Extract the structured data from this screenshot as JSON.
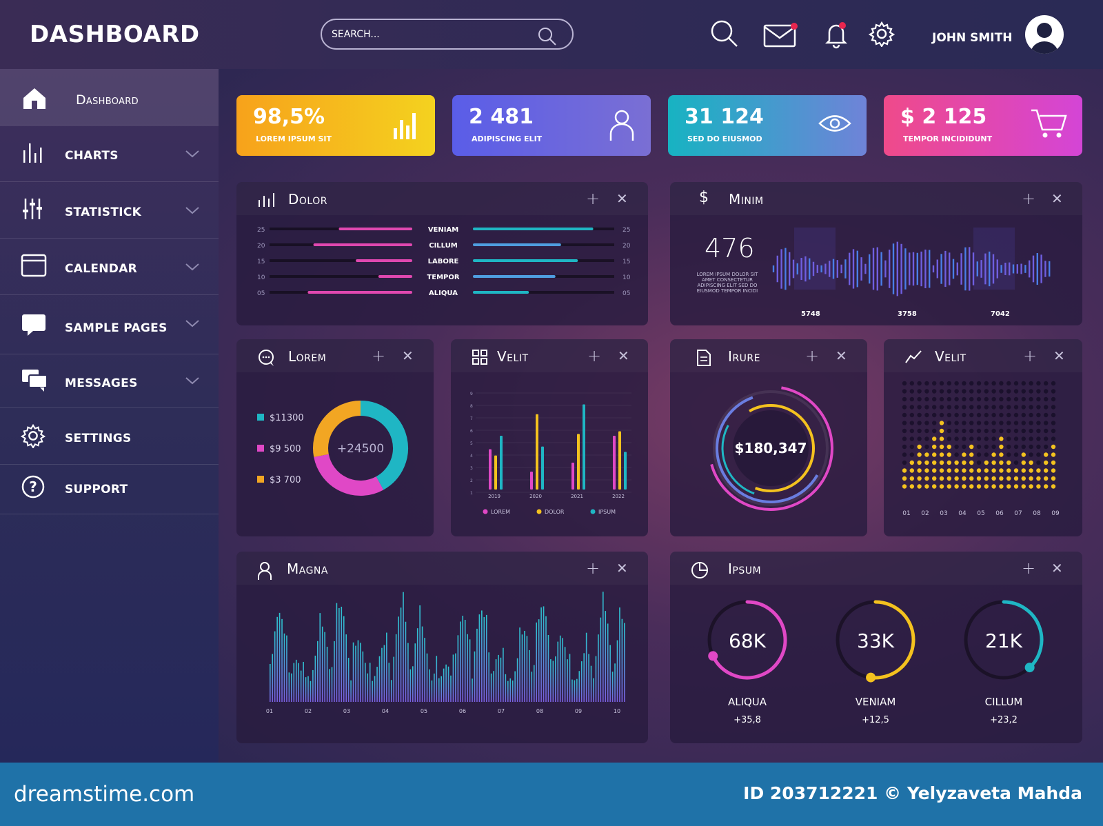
{
  "header": {
    "title": "DASHBOARD",
    "search_placeholder": "SEARCH...",
    "user_name": "JOHN SMITH"
  },
  "sidebar": {
    "items": [
      {
        "label": "Dashboard",
        "icon": "home-icon"
      },
      {
        "label": "CHARTS",
        "icon": "bar-chart-icon"
      },
      {
        "label": "STATISTICK",
        "icon": "sliders-icon"
      },
      {
        "label": "CALENDAR",
        "icon": "calendar-icon"
      },
      {
        "label": "SAMPLE PAGES",
        "icon": "pages-icon"
      },
      {
        "label": "MESSAGES",
        "icon": "messages-icon"
      },
      {
        "label": "SETTINGS",
        "icon": "gear-icon"
      },
      {
        "label": "SUPPORT",
        "icon": "help-icon"
      }
    ]
  },
  "stats": [
    {
      "value": "98,5%",
      "label": "LOREM IPSUM SIT",
      "icon": "bar-chart-icon",
      "colors": [
        "#f7a21b",
        "#f4d21f"
      ]
    },
    {
      "value": "2 481",
      "label": "ADIPISCING ELIT",
      "icon": "user-icon",
      "colors": [
        "#5a5de8",
        "#7a6fd4"
      ]
    },
    {
      "value": "31 124",
      "label": "SED DO EIUSMOD",
      "icon": "eye-icon",
      "colors": [
        "#17b3c2",
        "#6f83d8"
      ]
    },
    {
      "value": "$ 2 125",
      "label": "TEMPOR INCIDIDUNT",
      "icon": "cart-icon",
      "colors": [
        "#ef4a8a",
        "#d445d6"
      ]
    }
  ],
  "panels": {
    "dolor": {
      "title": "Dolor",
      "rows": [
        "VENIAM",
        "CILLUM",
        "LABORE",
        "TEMPOR",
        "ALIQUA"
      ],
      "left_ticks": [
        "25",
        "20",
        "15",
        "10",
        "05"
      ],
      "right_ticks": [
        "25",
        "20",
        "15",
        "10",
        "05"
      ],
      "left_values": [
        0.5,
        0.68,
        0.38,
        0.22,
        0.72
      ],
      "right_values": [
        0.84,
        0.61,
        0.73,
        0.57,
        0.38
      ]
    },
    "minim": {
      "title": "Minim",
      "value": "476",
      "text": "LOREM IPSUM DOLOR SIT AMET CONSECTETUR ADIPISCING ELIT SED DO EIUSMOD TEMPOR INCIDI",
      "labels": [
        "5748",
        "3758",
        "7042"
      ]
    },
    "lorem": {
      "title": "Lorem",
      "center": "+24500",
      "legend": [
        {
          "label": "$11300",
          "color": "#1fb6c4"
        },
        {
          "label": "$9 500",
          "color": "#e048c6"
        },
        {
          "label": "$3 700",
          "color": "#f2a623"
        }
      ]
    },
    "velit1": {
      "title": "Velit",
      "years": [
        "2019",
        "2020",
        "2021",
        "2022"
      ],
      "legend": [
        "LOREM",
        "DOLOR",
        "IPSUM"
      ],
      "y_ticks": [
        "9",
        "8",
        "7",
        "6",
        "5",
        "4",
        "3",
        "2",
        "1"
      ]
    },
    "irure": {
      "title": "Irure",
      "value": "$180,347"
    },
    "velit2": {
      "title": "Velit",
      "x": [
        "01",
        "02",
        "03",
        "04",
        "05",
        "06",
        "07",
        "08",
        "09"
      ]
    },
    "magna": {
      "title": "Magna",
      "x": [
        "01",
        "02",
        "03",
        "04",
        "05",
        "06",
        "07",
        "08",
        "09",
        "10"
      ]
    },
    "ipsum": {
      "title": "Ipsum",
      "gauges": [
        {
          "value": "68K",
          "label": "ALIQUA",
          "delta": "+35,8",
          "color": "#e048c6",
          "level": 0.68
        },
        {
          "value": "33K",
          "label": "VENIAM",
          "delta": "+12,5",
          "color": "#f4c21f",
          "level": 0.52
        },
        {
          "value": "21K",
          "label": "CILLUM",
          "delta": "+23,2",
          "color": "#1fb6c4",
          "level": 0.38
        }
      ]
    }
  },
  "footer": {
    "brand": "dreamstime.com",
    "credit": "ID 203712221 © Yelyzaveta Mahda"
  }
}
